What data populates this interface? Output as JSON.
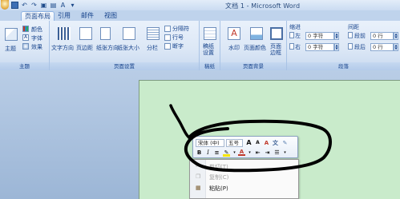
{
  "window": {
    "title": "文档 1 - Microsoft Word"
  },
  "tabs": [
    {
      "label": "页面布局",
      "active": true
    },
    {
      "label": "引用",
      "active": false
    },
    {
      "label": "邮件",
      "active": false
    },
    {
      "label": "视图",
      "active": false
    }
  ],
  "ribbon": {
    "themes": {
      "theme_label": "主题",
      "colors_label": "颜色",
      "fonts_label": "字体",
      "effects_label": "效果",
      "group_label": "主题"
    },
    "page_setup": {
      "text_direction": "文字方向",
      "margins": "页边距",
      "orientation": "纸张方向",
      "size": "纸张大小",
      "columns": "分栏",
      "breaks": "分隔符",
      "line_numbers": "行号",
      "hyphenation": "断字",
      "group_label": "页面设置"
    },
    "manuscript": {
      "label": "稿纸\n设置",
      "group_label": "稿纸"
    },
    "page_background": {
      "watermark": "水印",
      "page_color": "页面颜色",
      "page_borders": "页面\n边框",
      "group_label": "页面背景"
    },
    "paragraph": {
      "indent_header": "缩进",
      "spacing_header": "间距",
      "left_label": "左",
      "right_label": "右",
      "left_value": "0 字符",
      "right_value": "0 字符",
      "before_label": "段前",
      "after_label": "段后",
      "before_value": "0 行",
      "after_value": "0 行",
      "group_label": "段落"
    }
  },
  "mini_toolbar": {
    "font_name": "宋体 (中)",
    "font_size": "五号",
    "grow": "A",
    "shrink": "A",
    "format_painter_glyph": "A",
    "bold": "B",
    "italic": "I"
  },
  "context_menu": {
    "items": [
      {
        "label": "剪切(T)",
        "enabled": false
      },
      {
        "label": "复制(C)",
        "enabled": false
      },
      {
        "label": "粘贴(P)",
        "enabled": true
      }
    ]
  },
  "colors": {
    "page": "#c9ebcb",
    "ribbon_text": "#15428b",
    "scribble": "#000000"
  }
}
